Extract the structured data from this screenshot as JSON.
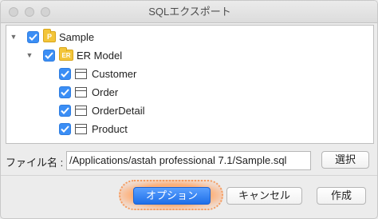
{
  "window": {
    "title": "SQLエクスポート"
  },
  "tree": {
    "root": {
      "label": "Sample",
      "checked": true,
      "icon": "package-icon",
      "badge": "P"
    },
    "model": {
      "label": "ER Model",
      "checked": true,
      "icon": "er-model-icon",
      "badge": "ER"
    },
    "tables": [
      {
        "label": "Customer",
        "checked": true
      },
      {
        "label": "Order",
        "checked": true
      },
      {
        "label": "OrderDetail",
        "checked": true
      },
      {
        "label": "Product",
        "checked": true
      }
    ]
  },
  "file": {
    "label": "ファイル名 :",
    "value": "/Applications/astah professional 7.1/Sample.sql",
    "select_label": "選択"
  },
  "buttons": {
    "options": "オプション",
    "cancel": "キャンセル",
    "create": "作成"
  },
  "colors": {
    "accent": "#2f7de0",
    "highlight": "#f59a5d"
  }
}
